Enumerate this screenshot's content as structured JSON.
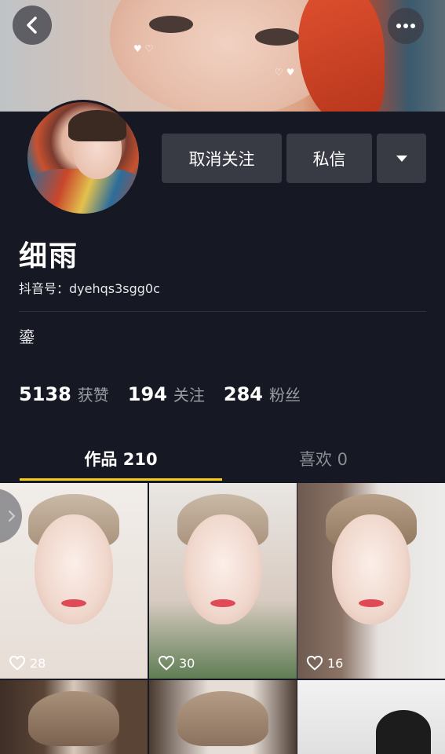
{
  "header": {
    "back_icon": "chevron-left-icon",
    "more_icon": "ellipsis-icon"
  },
  "actions": {
    "unfollow_label": "取消关注",
    "message_label": "私信",
    "dropdown_icon": "triangle-down-icon"
  },
  "profile": {
    "name": "细雨",
    "douyin_id": "抖音号：dyehqs3sgg0c",
    "bio": "鎏"
  },
  "stats": [
    {
      "value": "5138",
      "label": "获赞"
    },
    {
      "value": "194",
      "label": "关注"
    },
    {
      "value": "284",
      "label": "粉丝"
    }
  ],
  "tabs": [
    {
      "label": "作品 210",
      "active": true
    },
    {
      "label": "喜欢 0",
      "active": false
    }
  ],
  "videos": [
    {
      "likes": "28"
    },
    {
      "likes": "30"
    },
    {
      "likes": "16"
    },
    {
      "likes": ""
    },
    {
      "likes": ""
    },
    {
      "likes": ""
    }
  ],
  "colors": {
    "background": "#161823",
    "button": "#393b44",
    "tab_indicator": "#face15",
    "muted_text": "#9b9ca3"
  }
}
